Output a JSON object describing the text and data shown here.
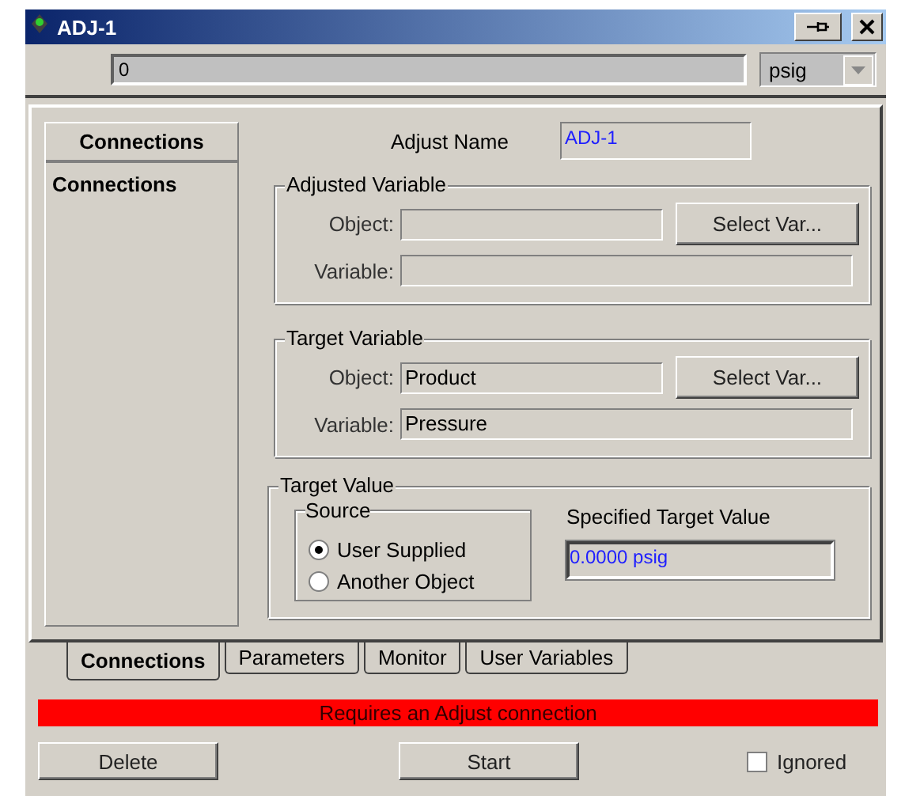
{
  "window": {
    "title": "ADJ-1"
  },
  "toolbar": {
    "value": "0",
    "unit": "psig"
  },
  "sidebar": {
    "header": "Connections",
    "items": [
      {
        "label": "Connections"
      }
    ]
  },
  "adjust_name": {
    "label": "Adjust Name",
    "value": "ADJ-1"
  },
  "groups": [
    {
      "title": "Adjusted Variable",
      "button": "Select Var...",
      "fields": [
        {
          "label": "Object:"
        },
        {
          "label": "Variable:"
        }
      ]
    },
    {
      "title": "Target Variable",
      "button": "Select Var...",
      "fields": [
        {
          "label": "Object:",
          "value": "Product"
        },
        {
          "label": "Variable:",
          "value": "Pressure"
        }
      ]
    }
  ],
  "target_value": {
    "title": "Target Value",
    "source": {
      "title": "Source",
      "options": [
        {
          "label": "User Supplied",
          "selected": true
        },
        {
          "label": "Another Object",
          "selected": false
        }
      ]
    },
    "specified_label": "Specified Target Value",
    "specified_value": "0.0000 psig"
  },
  "tabs": [
    {
      "label": "Connections",
      "selected": true
    },
    {
      "label": "Parameters",
      "selected": false
    },
    {
      "label": "Monitor",
      "selected": false
    },
    {
      "label": "User Variables",
      "selected": false
    }
  ],
  "status": "Requires an Adjust connection",
  "buttons": {
    "delete": "Delete",
    "start": "Start"
  },
  "ignored": {
    "label": "Ignored",
    "checked": false
  }
}
